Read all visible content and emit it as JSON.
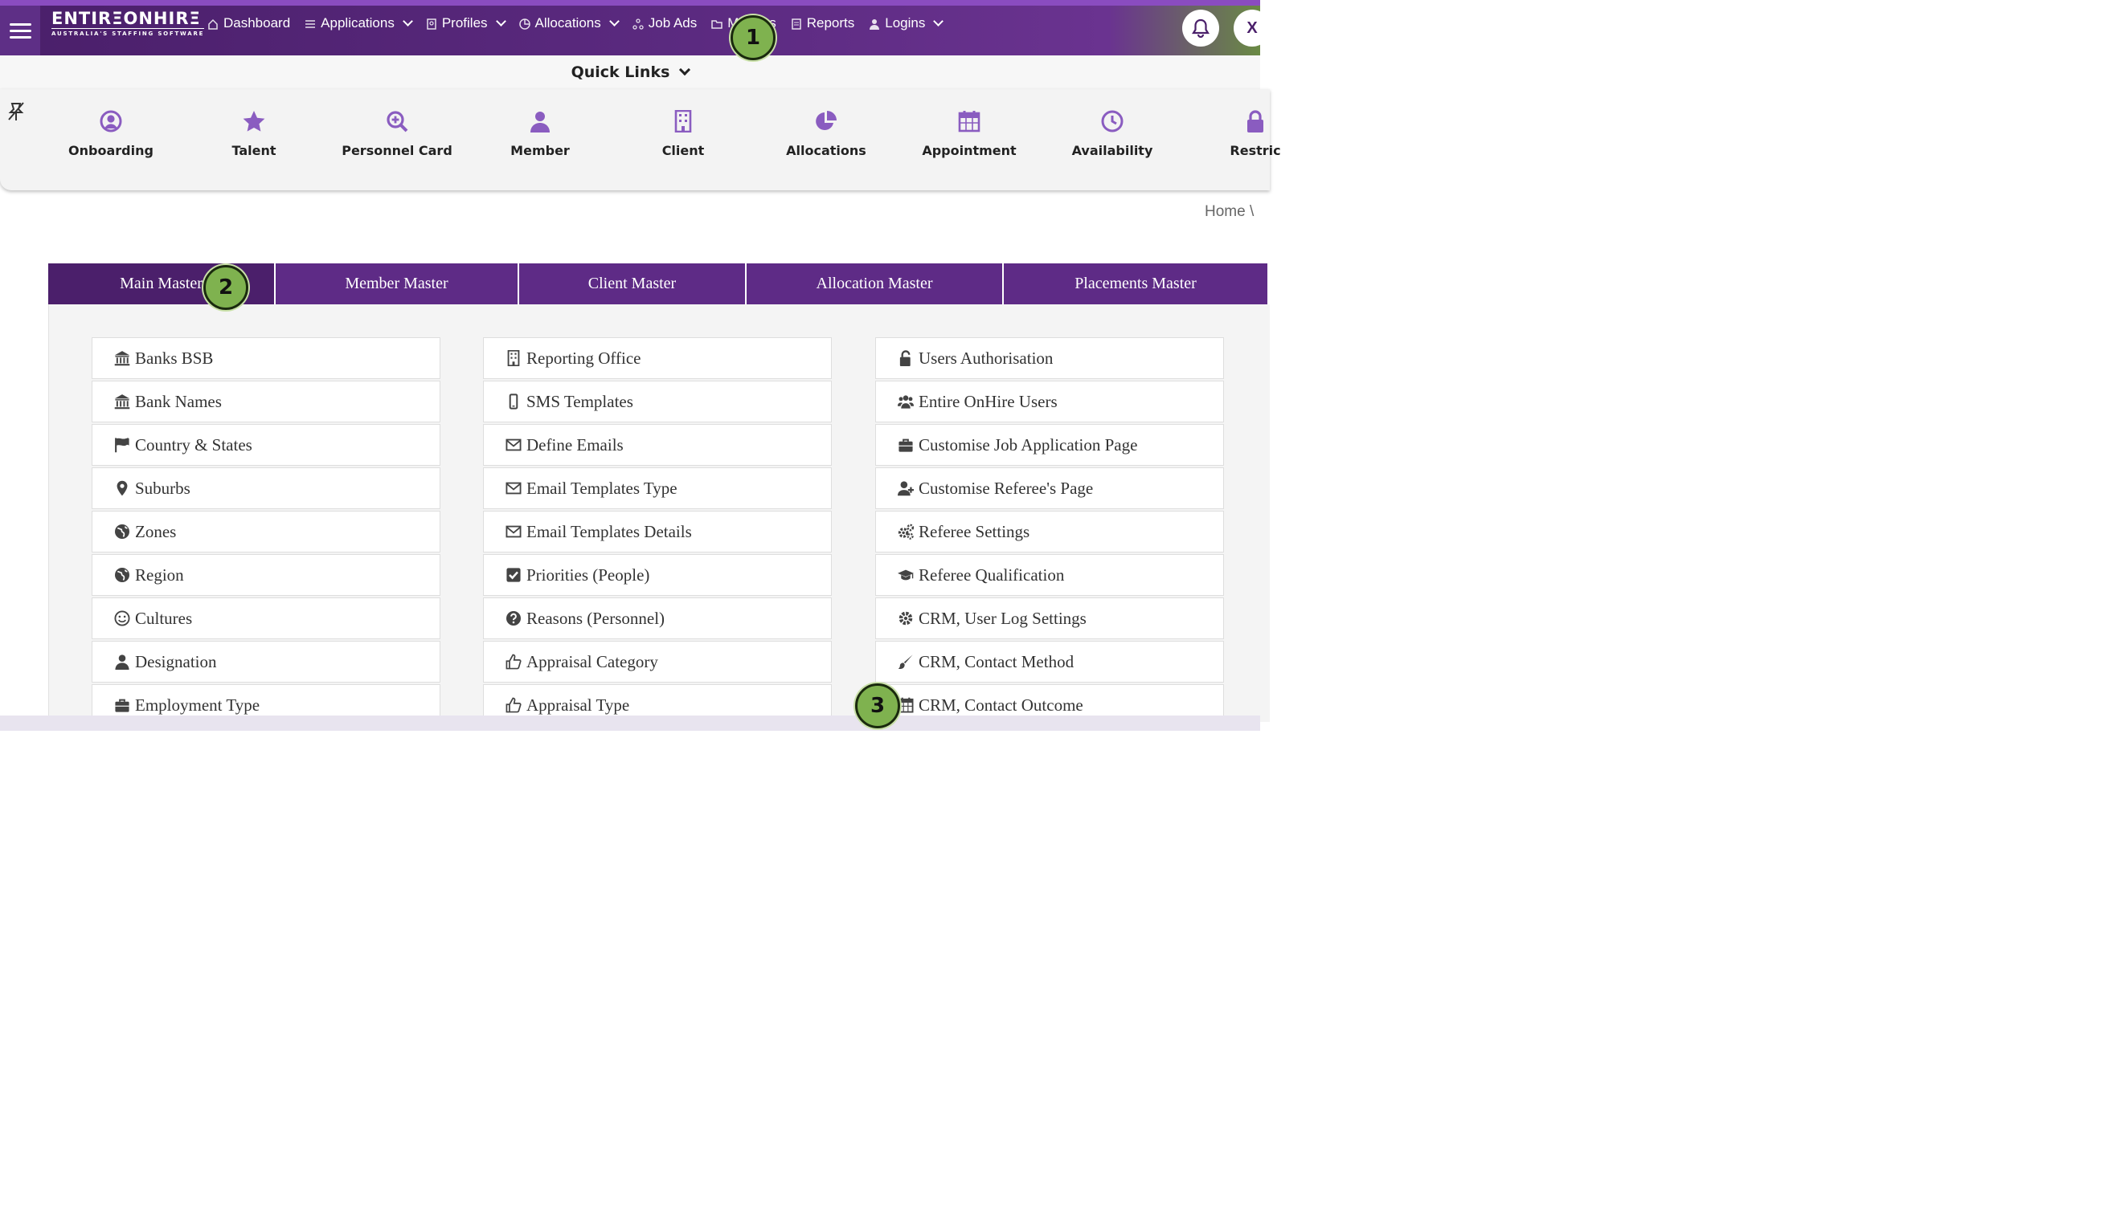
{
  "nav": {
    "logo_main": "ENTIRΞONHIRΞ",
    "logo_sub": "AUSTRALIA'S STAFFING SOFTWARE",
    "items": [
      {
        "label": "Dashboard",
        "icon": "home-icon",
        "dropdown": false
      },
      {
        "label": "Applications",
        "icon": "list-icon",
        "dropdown": true
      },
      {
        "label": "Profiles",
        "icon": "id-card-icon",
        "dropdown": true
      },
      {
        "label": "Allocations",
        "icon": "pie-icon",
        "dropdown": true
      },
      {
        "label": "Job Ads",
        "icon": "network-icon",
        "dropdown": false
      },
      {
        "label": "Masters",
        "icon": "folder-icon",
        "dropdown": false
      },
      {
        "label": "Reports",
        "icon": "document-icon",
        "dropdown": false
      },
      {
        "label": "Logins",
        "icon": "user-icon",
        "dropdown": true
      }
    ],
    "avatar_initial": "X"
  },
  "quick_links": {
    "title": "Quick Links",
    "items": [
      {
        "label": "Onboarding",
        "icon": "user-circle-icon"
      },
      {
        "label": "Talent",
        "icon": "star-icon"
      },
      {
        "label": "Personnel Card",
        "icon": "search-plus-icon"
      },
      {
        "label": "Member",
        "icon": "user-icon"
      },
      {
        "label": "Client",
        "icon": "building-icon"
      },
      {
        "label": "Allocations",
        "icon": "pie-chart-icon"
      },
      {
        "label": "Appointment",
        "icon": "calendar-icon"
      },
      {
        "label": "Availability",
        "icon": "clock-icon"
      },
      {
        "label": "Restric",
        "icon": "lock-icon"
      }
    ]
  },
  "breadcrumb": "Home \\",
  "tabs": [
    "Main Master",
    "Member Master",
    "Client Master",
    "Allocation Master",
    "Placements Master"
  ],
  "columns": [
    [
      {
        "label": "Banks BSB",
        "icon": "bank-icon"
      },
      {
        "label": "Bank Names",
        "icon": "bank-icon"
      },
      {
        "label": "Country & States",
        "icon": "flag-icon"
      },
      {
        "label": "Suburbs",
        "icon": "map-marker-icon"
      },
      {
        "label": "Zones",
        "icon": "globe-icon"
      },
      {
        "label": "Region",
        "icon": "globe-icon"
      },
      {
        "label": "Cultures",
        "icon": "smile-icon"
      },
      {
        "label": "Designation",
        "icon": "user-icon"
      },
      {
        "label": "Employment Type",
        "icon": "briefcase-icon"
      }
    ],
    [
      {
        "label": "Reporting Office",
        "icon": "building-icon"
      },
      {
        "label": "SMS Templates",
        "icon": "mobile-icon"
      },
      {
        "label": "Define Emails",
        "icon": "envelope-icon"
      },
      {
        "label": "Email Templates Type",
        "icon": "envelope-icon"
      },
      {
        "label": "Email Templates Details",
        "icon": "envelope-icon"
      },
      {
        "label": "Priorities (People)",
        "icon": "check-square-icon"
      },
      {
        "label": "Reasons (Personnel)",
        "icon": "question-circle-icon"
      },
      {
        "label": "Appraisal Category",
        "icon": "thumbs-up-icon"
      },
      {
        "label": "Appraisal Type",
        "icon": "thumbs-up-icon"
      }
    ],
    [
      {
        "label": "Users Authorisation",
        "icon": "unlock-icon"
      },
      {
        "label": "Entire OnHire Users",
        "icon": "users-icon"
      },
      {
        "label": "Customise Job Application Page",
        "icon": "briefcase-icon"
      },
      {
        "label": "Customise Referee's Page",
        "icon": "user-plus-icon"
      },
      {
        "label": "Referee Settings",
        "icon": "cogs-icon"
      },
      {
        "label": "Referee Qualification",
        "icon": "graduation-cap-icon"
      },
      {
        "label": "CRM, User Log Settings",
        "icon": "gear-icon"
      },
      {
        "label": "CRM, Contact Method",
        "icon": "brush-icon"
      },
      {
        "label": "CRM, Contact Outcome",
        "icon": "calendar-icon"
      }
    ]
  ],
  "markers": [
    "1",
    "2",
    "3"
  ],
  "colors": {
    "primary": "#5e2b86",
    "active_tab": "#4b1f6b",
    "icon_purple": "#8a5cc0",
    "marker": "#7fb24f"
  }
}
